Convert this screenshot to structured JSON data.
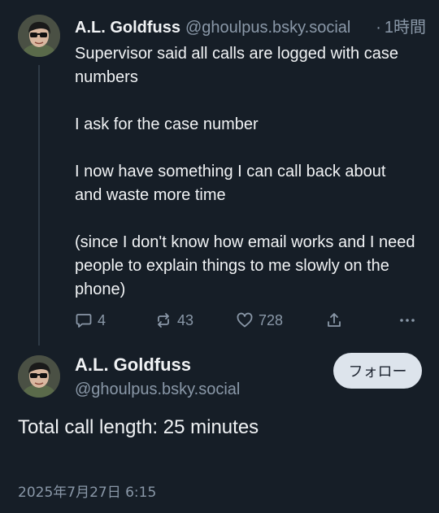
{
  "post1": {
    "display_name": "A.L. Goldfuss",
    "handle": "@ghoulpus.bsky.social",
    "time_separator": "·",
    "time": "1時間",
    "paragraphs": [
      "Supervisor said all calls are logged with case numbers",
      "I ask for the case number",
      "I now have something I can call back about and waste more time",
      "(since I don't know how email works and I need people to explain things to me slowly on the phone)"
    ],
    "actions": {
      "replies": "4",
      "reposts": "43",
      "likes": "728"
    },
    "icons": [
      "reply-icon",
      "repost-icon",
      "heart-icon",
      "share-icon",
      "more-icon"
    ]
  },
  "post2": {
    "display_name": "A.L. Goldfuss",
    "handle": "@ghoulpus.bsky.social",
    "follow_label": "フォロー",
    "body": "Total call length: 25 minutes",
    "timestamp": "2025年7月27日 6:15"
  },
  "colors": {
    "background": "#161e27",
    "text": "#f1f3f5",
    "muted": "#8a98a8",
    "follow_bg": "#dde4ec"
  }
}
